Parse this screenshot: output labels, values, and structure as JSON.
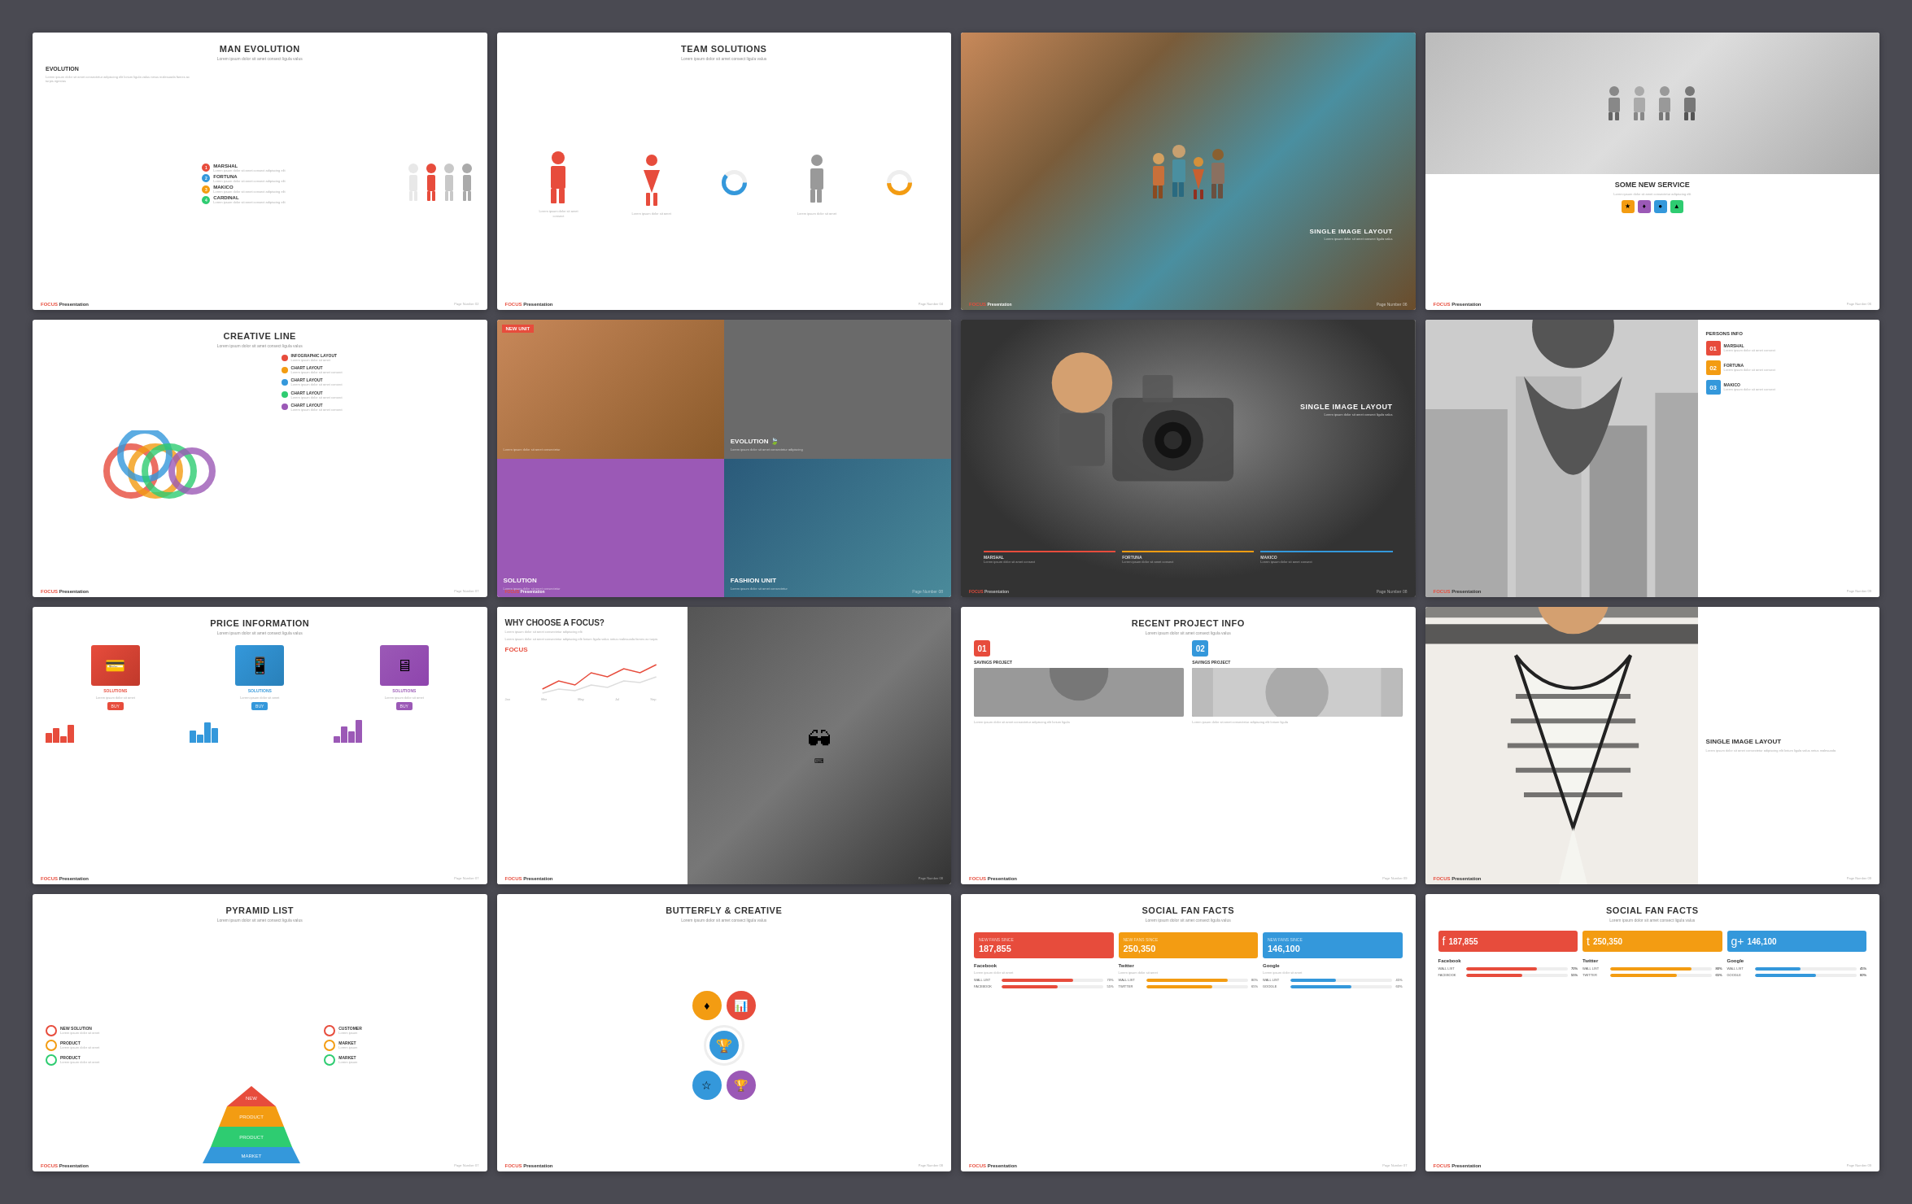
{
  "slides": [
    {
      "id": 1,
      "title": "MAN EVOLUTION",
      "subtitle": "Lorem ipsum dolor sit amet consect ligula valus",
      "section": "EVOLUTION",
      "persons": [
        {
          "name": "MARSHAL",
          "desc": "Lorem ipsum dolor sit amet consectetur adipiscing elit lorium ligula",
          "color": "#e74c3c",
          "num": "01"
        },
        {
          "name": "FORTUNA",
          "desc": "Lorem ipsum dolor sit amet consectetur adipiscing elit lorium ligula",
          "color": "#3498db",
          "num": "02"
        },
        {
          "name": "MAKICO",
          "desc": "Lorem ipsum dolor sit amet consectetur adipiscing elit lorium ligula",
          "color": "#f39c12",
          "num": "03"
        },
        {
          "name": "CARDINAL",
          "desc": "Lorem ipsum dolor sit amet consectetur adipiscing elit lorium ligula",
          "color": "#2ecc71",
          "num": "04"
        }
      ],
      "footer": {
        "brand": "FOCUS",
        "brandSub": "Presentation",
        "page": "Page Number 02"
      }
    },
    {
      "id": 2,
      "title": "TEAM SOLUTIONS",
      "subtitle": "Lorem ipsum dolor sit amet consect ligula valus",
      "footer": {
        "brand": "FOCUS",
        "brandSub": "Presentation",
        "page": "Page Number 04"
      }
    },
    {
      "id": 3,
      "title": "SINGLE IMAGE LAYOUT",
      "subtitle": "Lorem ipsum dolor sit amet consect ligula valus",
      "footer": {
        "brand": "FOCUS",
        "brandSub": "Presentation",
        "page": "Page Number 06"
      }
    },
    {
      "id": 4,
      "service_title": "SOME NEW SERVICE",
      "service_desc": "Lorem ipsum dolor sit amet consectetur adipiscing elit lorium ligula",
      "icons": [
        "★",
        "♦",
        "●",
        "▲"
      ],
      "icon_colors": [
        "#f39c12",
        "#9b59b6",
        "#3498db",
        "#2ecc71"
      ],
      "footer": {
        "brand": "FOCUS",
        "brandSub": "Presentation",
        "page": "Page Number 06"
      }
    },
    {
      "id": 5,
      "title": "CREATIVE LINE",
      "subtitle": "Lorem ipsum dolor sit amet consect ligula valus",
      "chart_labels": [
        "INFOGRAPHIC LAYOUT",
        "CHART LAYOUT",
        "CHART LAYOUT",
        "CHART LAYOUT",
        "CHART LAYOUT"
      ],
      "chart_colors": [
        "#e74c3c",
        "#f39c12",
        "#3498db",
        "#2ecc71",
        "#9b59b6"
      ],
      "footer": {
        "brand": "FOCUS",
        "brandSub": "Presentation",
        "page": "Page Number 07"
      }
    },
    {
      "id": 6,
      "cells": [
        {
          "label": "NEW UNIT",
          "sub": "Lorem ipsum dolor",
          "bg": "#c8885a"
        },
        {
          "label": "EVOLUTION",
          "sub": "Lorem ipsum dolor",
          "bg": "#6a6a6a"
        },
        {
          "label": "SOLUTION",
          "sub": "Lorem ipsum dolor",
          "bg": "#9b59b6"
        },
        {
          "label": "FASHION UNIT",
          "sub": "Lorem ipsum dolor",
          "bg": "#3d6e8c"
        }
      ],
      "footer": {
        "brand": "FOCUS",
        "brandSub": "Presentation",
        "page": "Page Number 08"
      }
    },
    {
      "id": 7,
      "title": "SINGLE IMAGE LAYOUT",
      "subtitle": "Lorem ipsum dolor sit amet consect ligula valus",
      "columns": [
        {
          "name": "MARSHAL",
          "color": "#e74c3c"
        },
        {
          "name": "FORTUNA",
          "color": "#f39c12"
        },
        {
          "name": "MAKICO",
          "color": "#3498db"
        }
      ],
      "footer": {
        "brand": "FOCUS",
        "brandSub": "Presentation",
        "page": "Page Number 08"
      }
    },
    {
      "id": 8,
      "persons": [
        {
          "num": "01",
          "name": "MARSHAL",
          "color": "#e74c3c"
        },
        {
          "num": "02",
          "name": "FORTUNA",
          "color": "#f39c12"
        },
        {
          "num": "03",
          "name": "MAKICO",
          "color": "#3498db"
        }
      ],
      "footer": {
        "brand": "FOCUS",
        "brandSub": "Presentation",
        "page": "Page Number 09"
      }
    },
    {
      "id": 9,
      "title": "PRICE INFORMATION",
      "subtitle": "Lorem ipsum dolor sit amet consect ligula valus",
      "cards": [
        {
          "label": "SOLUTIONS",
          "color": "#e74c3c"
        },
        {
          "label": "SOLUTIONS",
          "color": "#3498db"
        },
        {
          "label": "SOLUTIONS",
          "color": "#9b59b6"
        }
      ],
      "footer": {
        "brand": "FOCUS",
        "brandSub": "Presentation",
        "page": "Page Number 07"
      }
    },
    {
      "id": 10,
      "title": "WHY CHOOSE A FOCUS?",
      "subtitle": "Lorem ipsum dolor sit amet consect ligula valus",
      "desc": "Lorem ipsum dolor sit amet consectetur adipiscing elit lorium ligula valus netus malesuada",
      "brand_highlight": "FOCUS",
      "footer": {
        "brand": "FOCUS",
        "brandSub": "Presentation",
        "page": "Page Number 08"
      }
    },
    {
      "id": 11,
      "title": "RECENT PROJECT INFO",
      "subtitle": "Lorem ipsum dolor sit amet consect ligula valus",
      "projects": [
        {
          "num": "01",
          "label": "SAVINGS PROJECT",
          "color": "#e74c3c"
        },
        {
          "num": "02",
          "label": "SAVINGS PROJECT",
          "color": "#3498db"
        }
      ],
      "footer": {
        "brand": "FOCUS",
        "brandSub": "Presentation",
        "page": "Page Number 09"
      }
    },
    {
      "id": 12,
      "title": "SINGLE IMAGE LAYOUT",
      "desc": "Lorem ipsum dolor sit amet consectetur adipiscing elit lorium ligula valus netus malesuada",
      "footer": {
        "brand": "FOCUS",
        "brandSub": "Presentation",
        "page": "Page Number 09"
      }
    },
    {
      "id": 13,
      "title": "PYRAMID LIST",
      "subtitle": "Lorem ipsum dolor sit amet consect ligula valus",
      "pyramid_levels": [
        {
          "label": "NEW SOLUTION",
          "color": "#e74c3c"
        },
        {
          "label": "PRODUCT",
          "color": "#f39c12"
        },
        {
          "label": "PRODUCT",
          "color": "#2ecc71"
        },
        {
          "label": "MARKET",
          "color": "#3498db"
        }
      ],
      "right_labels": [
        {
          "label": "CUSTOMER",
          "color": "#e74c3c"
        },
        {
          "label": "MARKET",
          "color": "#f39c12"
        },
        {
          "label": "MARKET",
          "color": "#2ecc71"
        }
      ],
      "footer": {
        "brand": "FOCUS",
        "brandSub": "Presentation",
        "page": "Page Number 07"
      }
    },
    {
      "id": 14,
      "title": "BUTTERFLY & CREATIVE",
      "subtitle": "Lorem ipsum dolor sit amet consect ligula valus",
      "circles": [
        {
          "icon": "♦",
          "color": "#f39c12"
        },
        {
          "icon": "📊",
          "color": "#e74c3c"
        },
        {
          "icon": "☆",
          "color": "#3498db"
        },
        {
          "icon": "🏆",
          "color": "#9b59b6"
        }
      ],
      "footer": {
        "brand": "FOCUS",
        "brandSub": "Presentation",
        "page": "Page Number 08"
      }
    },
    {
      "id": 15,
      "title": "SOCIAL FAN FACTS",
      "subtitle": "Lorem ipsum dolor sit amet consect ligula valus",
      "stats": [
        {
          "platform": "Facebook",
          "number": "187,855",
          "color": "#e74c3c"
        },
        {
          "platform": "Twitter",
          "number": "250,350",
          "color": "#f39c12"
        },
        {
          "platform": "Google+",
          "number": "146,100",
          "color": "#3498db"
        }
      ],
      "bars": [
        {
          "label": "WALL LIST",
          "pct": 70,
          "color": "#e74c3c"
        },
        {
          "label": "FACEBOOK",
          "pct": 55,
          "color": "#e74c3c"
        },
        {
          "label": "WALL LIST",
          "pct": 80,
          "color": "#f39c12"
        },
        {
          "label": "TWITTER",
          "pct": 65,
          "color": "#f39c12"
        },
        {
          "label": "WALL LIST",
          "pct": 45,
          "color": "#3498db"
        },
        {
          "label": "GOOGLE",
          "pct": 60,
          "color": "#3498db"
        }
      ],
      "footer": {
        "brand": "FOCUS",
        "brandSub": "Presentation",
        "page": "Page Number 07"
      }
    },
    {
      "id": 16,
      "title": "SOCIAL FAN FACTS",
      "subtitle": "Lorem ipsum dolor sit amet consect ligula valus",
      "stats2": [
        {
          "platform": "Facebook",
          "number": "187,855",
          "color": "#e74c3c",
          "icon": "f"
        },
        {
          "platform": "Twitter",
          "number": "250,350",
          "color": "#f39c12",
          "icon": "t"
        },
        {
          "platform": "Google+",
          "number": "146,100",
          "color": "#3498db",
          "icon": "g+"
        }
      ],
      "footer": {
        "brand": "FOCUS",
        "brandSub": "Presentation",
        "page": "Page Number 09"
      }
    }
  ],
  "bg_color": "#4a4a52"
}
